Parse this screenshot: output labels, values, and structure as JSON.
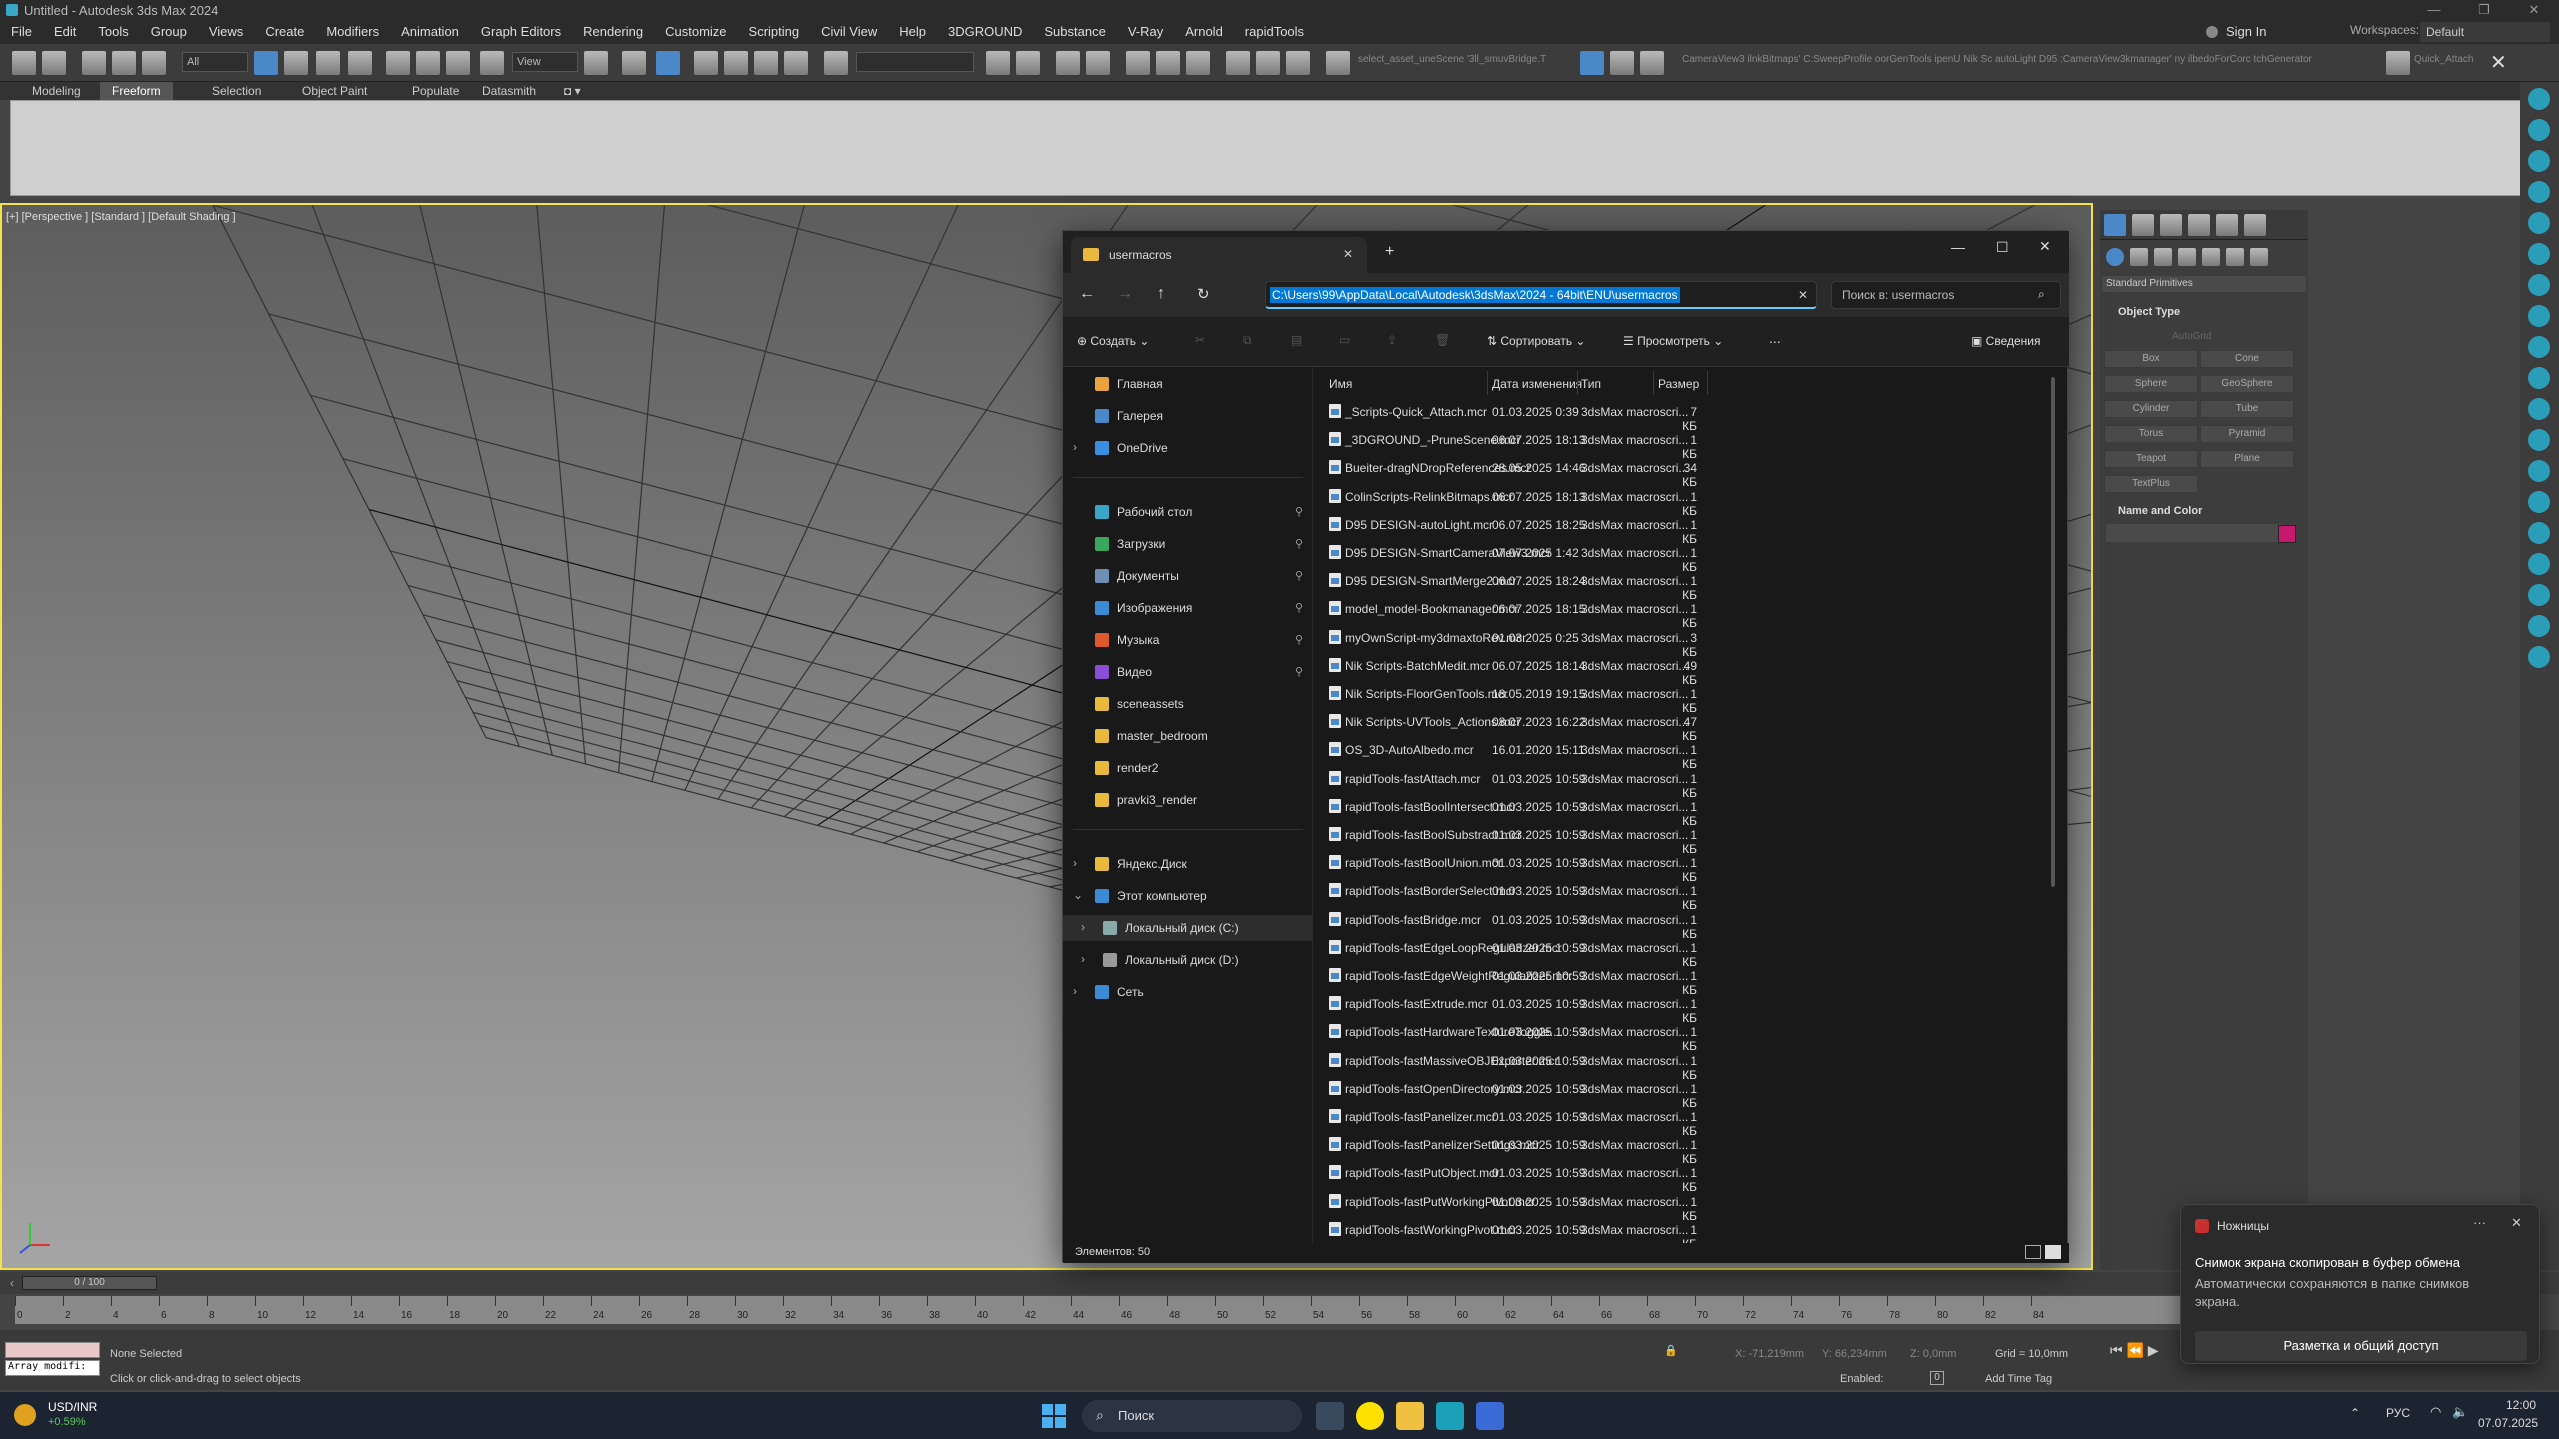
{
  "app": {
    "title": "Untitled - Autodesk 3ds Max 2024",
    "menu": [
      "File",
      "Edit",
      "Tools",
      "Group",
      "Views",
      "Create",
      "Modifiers",
      "Animation",
      "Graph Editors",
      "Rendering",
      "Customize",
      "Scripting",
      "Civil View",
      "Help",
      "3DGROUND",
      "Substance",
      "V-Ray",
      "Arnold",
      "rapidTools"
    ],
    "sign_in": "Sign In",
    "workspaces_label": "Workspaces:",
    "workspace": "Default",
    "selection_filter": "All",
    "ref_coord": "View",
    "toolbar_path_text": "select_asset_uneScene '3ll_smuvBridge.T",
    "toolbar_path_text2": "CameraView3 ilnkBitmaps' C:SweepProfile oorGenTools ipenU Nik Sc autoLight D95 :CameraView3kmanager' ny ilbedoForCorc tchGenerator",
    "quick_attach": "Quick_Attach",
    "ribbon_tabs": [
      "Modeling",
      "Freeform",
      "Selection",
      "Object Paint",
      "Populate",
      "Datasmith"
    ],
    "ribbon_active": "Freeform",
    "viewport_label": "[+] [Perspective ] [Standard ] [Default Shading ]",
    "colors": {
      "accent": "#f2e34a",
      "selection_blue": "#0078d4",
      "object_color": "#c8186e"
    }
  },
  "command_panel": {
    "category": "Standard Primitives",
    "object_type_header": "Object Type",
    "autogrid": "AutoGrid",
    "buttons": [
      "Box",
      "Cone",
      "Sphere",
      "GeoSphere",
      "Cylinder",
      "Tube",
      "Torus",
      "Pyramid",
      "Teapot",
      "Plane",
      "TextPlus"
    ],
    "name_color_header": "Name and Color"
  },
  "timeline": {
    "slider": "0 / 100",
    "ticks": [
      "0",
      "2",
      "4",
      "6",
      "8",
      "10",
      "12",
      "14",
      "16",
      "18",
      "20",
      "22",
      "24",
      "26",
      "28",
      "30",
      "32",
      "34",
      "36",
      "38",
      "40",
      "42",
      "44",
      "46",
      "48",
      "50",
      "52",
      "54",
      "56",
      "58",
      "60",
      "62",
      "64",
      "66",
      "68",
      "70",
      "72",
      "74",
      "76",
      "78",
      "80",
      "82",
      "84"
    ]
  },
  "status": {
    "selection": "None Selected",
    "prompt": "Click or click-and-drag to select objects",
    "maxscript": "Array modifi:",
    "x": "X: -71,219mm",
    "y": "Y: 66,234mm",
    "z": "Z: 0,0mm",
    "grid": "Grid = 10,0mm",
    "enabled": "Enabled:",
    "enabled_val": "0",
    "add_time_tag": "Add Time Tag"
  },
  "explorer": {
    "tab_title": "usermacros",
    "path": "C:\\Users\\99\\AppData\\Local\\Autodesk\\3dsMax\\2024 - 64bit\\ENU\\usermacros",
    "search_placeholder": "Поиск в: usermacros",
    "cmd": {
      "create": "Создать",
      "sort": "Сортировать",
      "view": "Просмотреть",
      "more": "...",
      "details": "Сведения"
    },
    "columns": {
      "name": "Имя",
      "date": "Дата изменения",
      "type": "Тип",
      "size": "Размер"
    },
    "nav": [
      {
        "label": "Главная",
        "color": "#e8a33d",
        "chev": ""
      },
      {
        "label": "Галерея",
        "color": "#4b88c7",
        "chev": ""
      },
      {
        "label": "OneDrive",
        "color": "#3b8fe0",
        "chev": "›"
      },
      {
        "label": "Рабочий стол",
        "color": "#3aa7c9",
        "chev": "",
        "pin": true
      },
      {
        "label": "Загрузки",
        "color": "#3aa760",
        "chev": "",
        "pin": true
      },
      {
        "label": "Документы",
        "color": "#6f8fb5",
        "chev": "",
        "pin": true
      },
      {
        "label": "Изображения",
        "color": "#3a8ad6",
        "chev": "",
        "pin": true
      },
      {
        "label": "Музыка",
        "color": "#e0582e",
        "chev": "",
        "pin": true
      },
      {
        "label": "Видео",
        "color": "#8a4fd6",
        "chev": "",
        "pin": true
      },
      {
        "label": "sceneassets",
        "color": "#e8b93d",
        "chev": ""
      },
      {
        "label": "master_bedroom",
        "color": "#e8b93d",
        "chev": ""
      },
      {
        "label": "render2",
        "color": "#e8b93d",
        "chev": ""
      },
      {
        "label": "pravki3_render",
        "color": "#e8b93d",
        "chev": ""
      },
      {
        "label": "Яндекс.Диск",
        "color": "#e8b93d",
        "chev": "›"
      },
      {
        "label": "Этот компьютер",
        "color": "#3a8ad6",
        "chev": "⌄"
      },
      {
        "label": "Локальный диск (C:)",
        "color": "#8aa",
        "chev": "›",
        "sel": true
      },
      {
        "label": "Локальный диск (D:)",
        "color": "#999",
        "chev": "›"
      },
      {
        "label": "Сеть",
        "color": "#3a8ad6",
        "chev": "›"
      }
    ],
    "files": [
      {
        "name": "_Scripts-Quick_Attach.mcr",
        "date": "01.03.2025 0:39",
        "type": "3dsMax macroscri...",
        "size": "7 КБ"
      },
      {
        "name": "_3DGROUND_-PruneScene.mcr",
        "date": "06.07.2025 18:13",
        "type": "3dsMax macroscri...",
        "size": "1 КБ"
      },
      {
        "name": "Bueiter-dragNDropReferences.mcr",
        "date": "28.05.2025 14:46",
        "type": "3dsMax macroscri...",
        "size": "34 КБ"
      },
      {
        "name": "ColinScripts-RelinkBitmaps.mcr",
        "date": "06.07.2025 18:13",
        "type": "3dsMax macroscri...",
        "size": "1 КБ"
      },
      {
        "name": "D95 DESIGN-autoLight.mcr",
        "date": "06.07.2025 18:25",
        "type": "3dsMax macroscri...",
        "size": "1 КБ"
      },
      {
        "name": "D95 DESIGN-SmartCameraView3.mcr",
        "date": "07.07.2025 1:42",
        "type": "3dsMax macroscri...",
        "size": "1 КБ"
      },
      {
        "name": "D95 DESIGN-SmartMerge2.mcr",
        "date": "06.07.2025 18:24",
        "type": "3dsMax macroscri...",
        "size": "1 КБ"
      },
      {
        "name": "model_model-Bookmanager.mcr",
        "date": "06.07.2025 18:15",
        "type": "3dsMax macroscri...",
        "size": "1 КБ"
      },
      {
        "name": "myOwnScript-my3dmaxtoRev.mcr",
        "date": "01.03.2025 0:25",
        "type": "3dsMax macroscri...",
        "size": "3 КБ"
      },
      {
        "name": "Nik Scripts-BatchMedit.mcr",
        "date": "06.07.2025 18:14",
        "type": "3dsMax macroscri...",
        "size": "49 КБ"
      },
      {
        "name": "Nik Scripts-FloorGenTools.mcr",
        "date": "18.05.2019 19:15",
        "type": "3dsMax macroscri...",
        "size": "1 КБ"
      },
      {
        "name": "Nik Scripts-UVTools_Actions.mcr",
        "date": "08.07.2023 16:22",
        "type": "3dsMax macroscri...",
        "size": "47 КБ"
      },
      {
        "name": "OS_3D-AutoAlbedo.mcr",
        "date": "16.01.2020 15:11",
        "type": "3dsMax macroscri...",
        "size": "1 КБ"
      },
      {
        "name": "rapidTools-fastAttach.mcr",
        "date": "01.03.2025 10:59",
        "type": "3dsMax macroscri...",
        "size": "1 КБ"
      },
      {
        "name": "rapidTools-fastBoolIntersect.mcr",
        "date": "01.03.2025 10:59",
        "type": "3dsMax macroscri...",
        "size": "1 КБ"
      },
      {
        "name": "rapidTools-fastBoolSubstract.mcr",
        "date": "01.03.2025 10:59",
        "type": "3dsMax macroscri...",
        "size": "1 КБ"
      },
      {
        "name": "rapidTools-fastBoolUnion.mcr",
        "date": "01.03.2025 10:59",
        "type": "3dsMax macroscri...",
        "size": "1 КБ"
      },
      {
        "name": "rapidTools-fastBorderSelect.mcr",
        "date": "01.03.2025 10:59",
        "type": "3dsMax macroscri...",
        "size": "1 КБ"
      },
      {
        "name": "rapidTools-fastBridge.mcr",
        "date": "01.03.2025 10:59",
        "type": "3dsMax macroscri...",
        "size": "1 КБ"
      },
      {
        "name": "rapidTools-fastEdgeLoopRegularizer.mcr",
        "date": "01.03.2025 10:59",
        "type": "3dsMax macroscri...",
        "size": "1 КБ"
      },
      {
        "name": "rapidTools-fastEdgeWeightRegularizer.mcr",
        "date": "01.03.2025 10:59",
        "type": "3dsMax macroscri...",
        "size": "1 КБ"
      },
      {
        "name": "rapidTools-fastExtrude.mcr",
        "date": "01.03.2025 10:59",
        "type": "3dsMax macroscri...",
        "size": "1 КБ"
      },
      {
        "name": "rapidTools-fastHardwareTextureToggle....",
        "date": "01.03.2025 10:59",
        "type": "3dsMax macroscri...",
        "size": "1 КБ"
      },
      {
        "name": "rapidTools-fastMassiveOBJExporter.mcr",
        "date": "01.03.2025 10:59",
        "type": "3dsMax macroscri...",
        "size": "1 КБ"
      },
      {
        "name": "rapidTools-fastOpenDirectory.mcr",
        "date": "01.03.2025 10:59",
        "type": "3dsMax macroscri...",
        "size": "1 КБ"
      },
      {
        "name": "rapidTools-fastPanelizer.mcr",
        "date": "01.03.2025 10:59",
        "type": "3dsMax macroscri...",
        "size": "1 КБ"
      },
      {
        "name": "rapidTools-fastPanelizerSettings.mcr",
        "date": "01.03.2025 10:59",
        "type": "3dsMax macroscri...",
        "size": "1 КБ"
      },
      {
        "name": "rapidTools-fastPutObject.mcr",
        "date": "01.03.2025 10:59",
        "type": "3dsMax macroscri...",
        "size": "1 КБ"
      },
      {
        "name": "rapidTools-fastPutWorkingPivot.mcr",
        "date": "01.03.2025 10:59",
        "type": "3dsMax macroscri...",
        "size": "1 КБ"
      },
      {
        "name": "rapidTools-fastWorkingPivot.mcr",
        "date": "01.03.2025 10:59",
        "type": "3dsMax macroscri...",
        "size": "1 КБ"
      }
    ],
    "status_count": "Элементов: 50"
  },
  "toast": {
    "app": "Ножницы",
    "title": "Снимок экрана скопирован в буфер обмена",
    "body": "Автоматически сохраняются в папке снимков экрана.",
    "button": "Разметка и общий доступ"
  },
  "taskbar": {
    "ticker_name": "USD/INR",
    "ticker_change": "+0.59%",
    "search": "Поиск",
    "lang": "РУС",
    "time": "12:00",
    "date": "07.07.2025"
  }
}
